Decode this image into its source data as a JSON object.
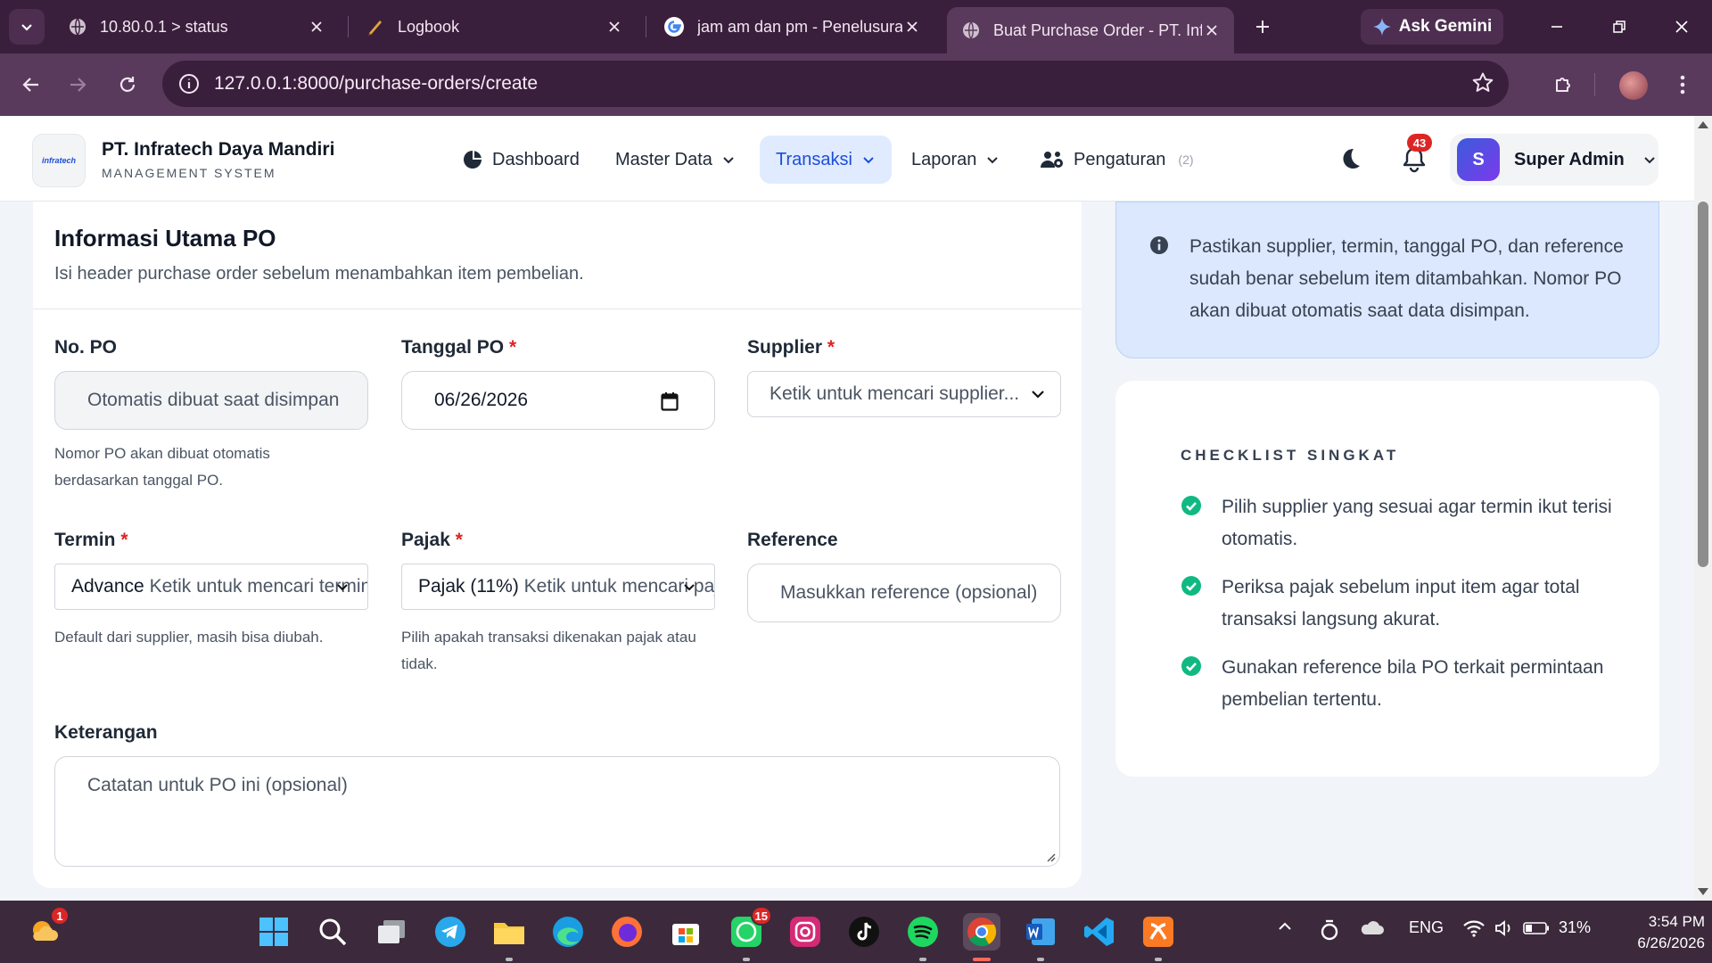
{
  "browser": {
    "tabs": [
      {
        "title": "10.80.0.1 > status",
        "icon": "globe-icon"
      },
      {
        "title": "Logbook",
        "icon": "logbook-icon"
      },
      {
        "title": "jam am dan pm - Penelusuran",
        "icon": "google-icon"
      },
      {
        "title": "Buat Purchase Order - PT. Infratech",
        "icon": "globe-icon",
        "active": true
      }
    ],
    "gemini_label": "Ask Gemini",
    "url": "127.0.0.1:8000/purchase-orders/create"
  },
  "app": {
    "logo_text": "infratech",
    "company_name": "PT. Infratech Daya Mandiri",
    "company_sub": "MANAGEMENT SYSTEM",
    "menu": [
      {
        "label": "Dashboard",
        "icon": "dashboard-icon"
      },
      {
        "label": "Master Data",
        "icon": "chevron-down-icon"
      },
      {
        "label": "Transaksi",
        "icon": "chevron-down-icon",
        "active": true
      },
      {
        "label": "Laporan",
        "icon": "chevron-down-icon"
      },
      {
        "label": "Pengaturan",
        "count": "(2)",
        "icon": "users-cog-icon"
      }
    ],
    "notification_count": "43",
    "user": {
      "initial": "S",
      "name": "Super Admin"
    }
  },
  "form": {
    "title": "Informasi Utama PO",
    "subtitle": "Isi header purchase order sebelum menambahkan item pembelian.",
    "no_po": {
      "label": "No. PO",
      "placeholder": "Otomatis dibuat saat disimpan",
      "hint": "Nomor PO akan dibuat otomatis berdasarkan tanggal PO."
    },
    "tanggal_po": {
      "label": "Tanggal PO",
      "required": "*",
      "value": "06/26/2026"
    },
    "supplier": {
      "label": "Supplier",
      "required": "*",
      "placeholder": "Ketik untuk mencari supplier..."
    },
    "termin": {
      "label": "Termin",
      "required": "*",
      "selected": "Advance",
      "placeholder": "Ketik untuk mencari termin",
      "hint": "Default dari supplier, masih bisa diubah."
    },
    "pajak": {
      "label": "Pajak",
      "required": "*",
      "selected": "Pajak (11%)",
      "placeholder": "Ketik untuk mencari pajak",
      "hint": "Pilih apakah transaksi dikenakan pajak atau tidak."
    },
    "reference": {
      "label": "Reference",
      "placeholder": "Masukkan reference (opsional)"
    },
    "keterangan": {
      "label": "Keterangan",
      "placeholder": "Catatan untuk PO ini (opsional)"
    }
  },
  "info": {
    "text": "Pastikan supplier, termin, tanggal PO, dan reference sudah benar sebelum item ditambahkan. Nomor PO akan dibuat otomatis saat data disimpan."
  },
  "checklist": {
    "heading": "CHECKLIST SINGKAT",
    "items": [
      "Pilih supplier yang sesuai agar termin ikut terisi otomatis.",
      "Periksa pajak sebelum input item agar total transaksi langsung akurat.",
      "Gunakan reference bila PO terkait permintaan pembelian tertentu."
    ]
  },
  "taskbar": {
    "weather_badge": "1",
    "whatsapp_badge": "15",
    "language": "ENG",
    "battery": "31%",
    "time": "3:54 PM",
    "date": "6/26/2026"
  },
  "colors": {
    "accent": "#1d4ed8",
    "required": "#dc2626",
    "check": "#10b981",
    "info_bg": "#dbe8fd"
  }
}
